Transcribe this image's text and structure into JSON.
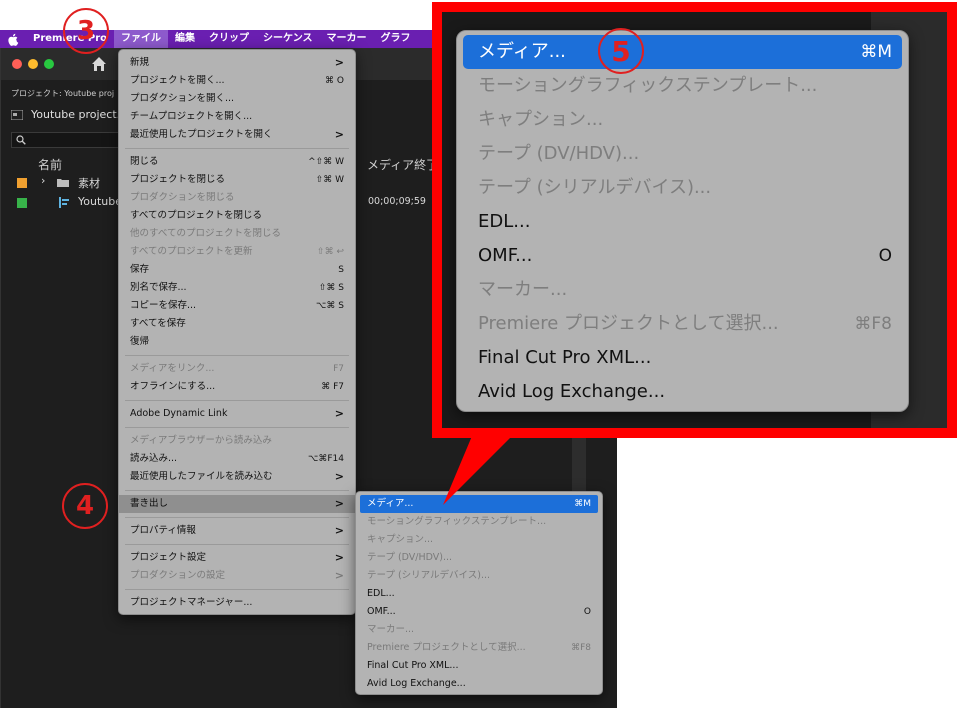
{
  "menubar": {
    "items": [
      "Premiere Pro",
      "ファイル",
      "編集",
      "クリップ",
      "シーケンス",
      "マーカー",
      "グラフ"
    ]
  },
  "project": {
    "path": "プロジェクト: Youtube proj",
    "tab_label": "Youtube project.",
    "column_name": "名前",
    "column_media_end": "メディア終了",
    "rows": [
      {
        "name": "素材",
        "color": "#f0a030"
      },
      {
        "name": "Youtube",
        "color": "#38b34a",
        "end": "00;00;09;59"
      }
    ]
  },
  "file_menu": {
    "items": [
      {
        "label": "新規",
        "arrow": ">"
      },
      {
        "label": "プロジェクトを開く...",
        "shortcut": "⌘ O"
      },
      {
        "label": "プロダクションを開く..."
      },
      {
        "label": "チームプロジェクトを開く..."
      },
      {
        "label": "最近使用したプロジェクトを開く",
        "arrow": ">"
      },
      {
        "sep": true
      },
      {
        "label": "閉じる",
        "shortcut": "^⇧⌘ W"
      },
      {
        "label": "プロジェクトを閉じる",
        "shortcut": "⇧⌘ W"
      },
      {
        "label": "プロダクションを閉じる",
        "disabled": true
      },
      {
        "label": "すべてのプロジェクトを閉じる"
      },
      {
        "label": "他のすべてのプロジェクトを閉じる",
        "disabled": true
      },
      {
        "label": "すべてのプロジェクトを更新",
        "shortcut": "⇧⌘ ↩",
        "disabled": true
      },
      {
        "label": "保存",
        "shortcut": "S"
      },
      {
        "label": "別名で保存...",
        "shortcut": "⇧⌘ S"
      },
      {
        "label": "コピーを保存...",
        "shortcut": "⌥⌘ S"
      },
      {
        "label": "すべてを保存"
      },
      {
        "label": "復帰"
      },
      {
        "sep": true
      },
      {
        "label": "メディアをリンク...",
        "shortcut": "F7",
        "disabled": true
      },
      {
        "label": "オフラインにする...",
        "shortcut": "⌘ F7"
      },
      {
        "sep": true
      },
      {
        "label": "Adobe Dynamic Link",
        "arrow": ">"
      },
      {
        "sep": true
      },
      {
        "label": "メディアブラウザーから読み込み",
        "disabled": true
      },
      {
        "label": "読み込み...",
        "shortcut": "⌥⌘F14"
      },
      {
        "label": "最近使用したファイルを読み込む",
        "arrow": ">"
      },
      {
        "sep": true
      },
      {
        "label": "書き出し",
        "arrow": ">",
        "selected": true
      },
      {
        "sep": true
      },
      {
        "label": "プロパティ情報",
        "arrow": ">"
      },
      {
        "sep": true
      },
      {
        "label": "プロジェクト設定",
        "arrow": ">"
      },
      {
        "label": "プロダクションの設定",
        "arrow": ">",
        "disabled": true
      },
      {
        "sep": true
      },
      {
        "label": "プロジェクトマネージャー..."
      }
    ]
  },
  "export_menu": {
    "items": [
      {
        "label": "メディア...",
        "shortcut": "⌘M",
        "highlight": true
      },
      {
        "label": "モーショングラフィックステンプレート...",
        "disabled": true
      },
      {
        "label": "キャプション...",
        "disabled": true
      },
      {
        "label": "テープ (DV/HDV)...",
        "disabled": true
      },
      {
        "label": "テープ (シリアルデバイス)...",
        "disabled": true
      },
      {
        "label": "EDL..."
      },
      {
        "label": "OMF...",
        "shortcut": "O"
      },
      {
        "label": "マーカー...",
        "disabled": true
      },
      {
        "label": "Premiere プロジェクトとして選択...",
        "shortcut": "⌘F8",
        "disabled": true
      },
      {
        "label": "Final Cut Pro XML..."
      },
      {
        "label": "Avid Log Exchange..."
      }
    ]
  },
  "steps": {
    "s3": "3",
    "s4": "4",
    "s5": "5"
  },
  "colors": {
    "menubar": "#6a1fb1",
    "highlight": "#1c6fd9",
    "callout": "#ff0000",
    "step": "#e02020"
  }
}
